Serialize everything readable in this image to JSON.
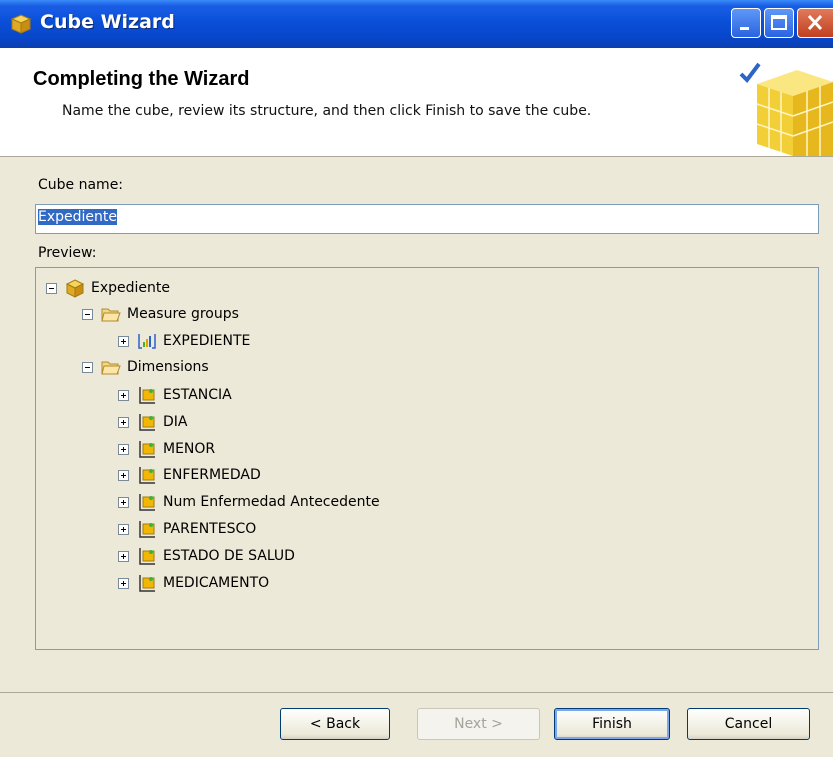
{
  "window": {
    "title": "Cube Wizard"
  },
  "header": {
    "title": "Completing the Wizard",
    "subtitle": "Name the cube, review its structure, and then click Finish to save the cube."
  },
  "form": {
    "cube_name_label": "Cube name:",
    "cube_name_value": "Expediente",
    "preview_label": "Preview:"
  },
  "tree": {
    "root": "Expediente",
    "measure_groups_label": "Measure groups",
    "measure_groups": [
      "EXPEDIENTE"
    ],
    "dimensions_label": "Dimensions",
    "dimensions": [
      "ESTANCIA",
      "DIA",
      "MENOR",
      "ENFERMEDAD",
      "Num Enfermedad Antecedente",
      "PARENTESCO",
      "ESTADO DE SALUD",
      "MEDICAMENTO"
    ]
  },
  "buttons": {
    "back": "< Back",
    "next": "Next >",
    "finish": "Finish",
    "cancel": "Cancel"
  },
  "colors": {
    "titlebar": "#0a4fd8",
    "dialog_bg": "#ece9d8",
    "selection": "#316ac5"
  }
}
